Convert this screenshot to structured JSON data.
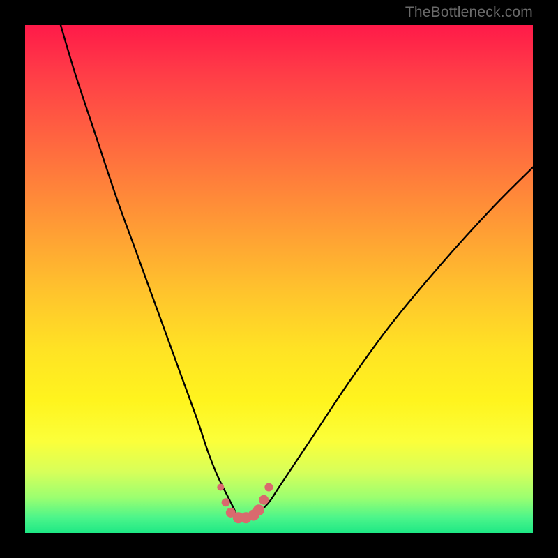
{
  "attribution": "TheBottleneck.com",
  "colors": {
    "page_bg": "#000000",
    "gradient_top": "#ff1a49",
    "gradient_mid": "#ffe324",
    "gradient_bottom": "#1ee885",
    "curve": "#000000",
    "dots": "#d96a6e"
  },
  "chart_data": {
    "type": "line",
    "title": "",
    "xlabel": "",
    "ylabel": "",
    "xlim": [
      0,
      100
    ],
    "ylim": [
      0,
      100
    ],
    "series": [
      {
        "name": "bottleneck-curve",
        "x": [
          7,
          10,
          14,
          18,
          22,
          26,
          30,
          34,
          36,
          38,
          40,
          41,
          42,
          43,
          44,
          45,
          46,
          48,
          50,
          54,
          58,
          64,
          72,
          82,
          92,
          100
        ],
        "y": [
          100,
          90,
          78,
          66,
          55,
          44,
          33,
          22,
          16,
          11,
          7,
          5,
          3,
          2.5,
          2.5,
          3,
          4,
          6,
          9,
          15,
          21,
          30,
          41,
          53,
          64,
          72
        ]
      }
    ],
    "markers": {
      "name": "trough-dots",
      "x": [
        38.5,
        39.5,
        40.5,
        42,
        43.5,
        45,
        46,
        47,
        48
      ],
      "y": [
        9,
        6,
        4,
        3,
        3,
        3.5,
        4.5,
        6.5,
        9
      ],
      "r": [
        5,
        6,
        7,
        8,
        8,
        8,
        8,
        7,
        6
      ]
    }
  }
}
